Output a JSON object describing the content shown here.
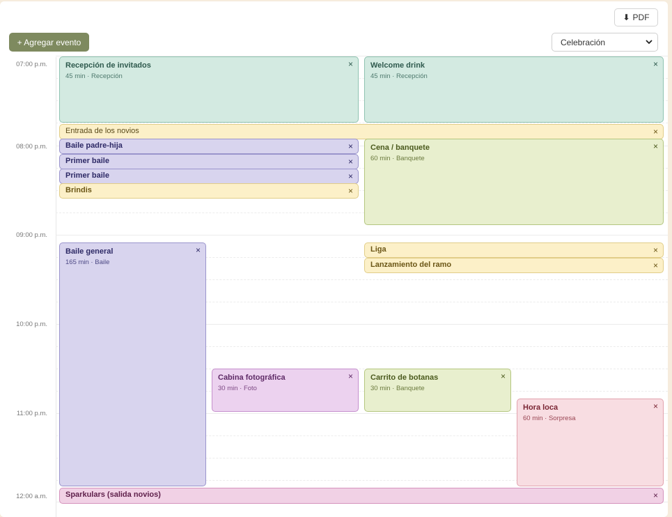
{
  "toolbar": {
    "pdf_label": "PDF",
    "add_label": "+ Agregar evento",
    "select_value": "Celebración"
  },
  "times": [
    "07:00 p.m.",
    "08:00 p.m.",
    "09:00 p.m.",
    "10:00 p.m.",
    "11:00 p.m.",
    "12:00 a.m."
  ],
  "events": [
    {
      "title": "Recepción de invitados",
      "meta": "45 min · Recepción"
    },
    {
      "title": "Welcome drink",
      "meta": "45 min · Recepción"
    },
    {
      "title": "Entrada de los novios"
    },
    {
      "title": "Baile padre-hija"
    },
    {
      "title": "Primer baile"
    },
    {
      "title": "Primer baile"
    },
    {
      "title": "Brindis"
    },
    {
      "title": "Cena / banquete",
      "meta": "60 min · Banquete"
    },
    {
      "title": "Baile general",
      "meta": "165 min · Baile"
    },
    {
      "title": "Liga"
    },
    {
      "title": "Lanzamiento del ramo"
    },
    {
      "title": "Cabina fotográfica",
      "meta": "30 min · Foto"
    },
    {
      "title": "Carrito de botanas",
      "meta": "30 min · Banquete"
    },
    {
      "title": "Hora loca",
      "meta": "60 min · Sorpresa"
    },
    {
      "title": "Sparkulars (salida novios)"
    }
  ],
  "close_glyph": "×",
  "colors": {
    "recepcion": "#d3eae1",
    "ceremonia": "#fcf0c8",
    "baile": "#d8d4ee",
    "banquete": "#e8efce",
    "foto": "#ecd2ef",
    "sorpresa": "#f8dde2",
    "salida": "#f1d1e5",
    "add_button": "#7e8a5f"
  }
}
